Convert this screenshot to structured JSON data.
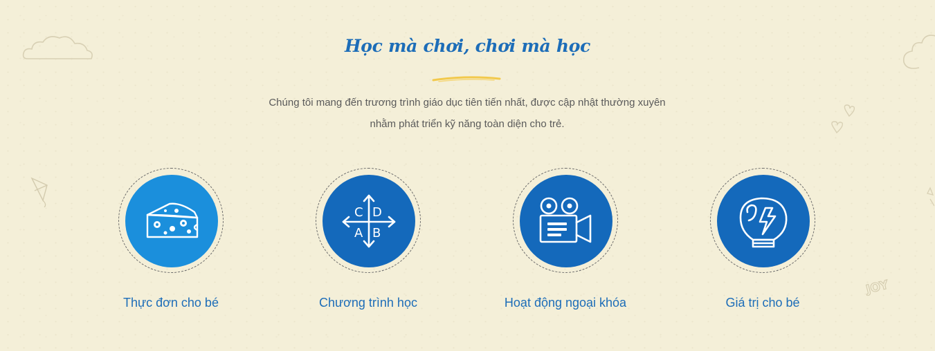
{
  "section": {
    "title": "Học mà chơi, chơi mà học",
    "intro": "Chúng tôi mang đến trương trình giáo dục tiên tiến nhất, được cập nhật thường xuyên nhằm phát triển kỹ năng toàn diện cho trẻ."
  },
  "features": [
    {
      "label": "Thực đơn cho bé",
      "icon": "cheese-icon"
    },
    {
      "label": "Chương trình học",
      "icon": "abcd-arrows-icon",
      "icon_letters": [
        "C",
        "D",
        "A",
        "B"
      ]
    },
    {
      "label": "Hoạt động ngoại khóa",
      "icon": "video-camera-icon"
    },
    {
      "label": "Giá trị cho bé",
      "icon": "boxing-glove-icon"
    }
  ],
  "decorations": {
    "joy_text": "JOY"
  },
  "colors": {
    "primary_blue": "#1469bb",
    "light_blue": "#1b8fdc",
    "title_blue": "#1d6db8",
    "underline_yellow": "#f2c94c",
    "background": "#f4efd8"
  }
}
